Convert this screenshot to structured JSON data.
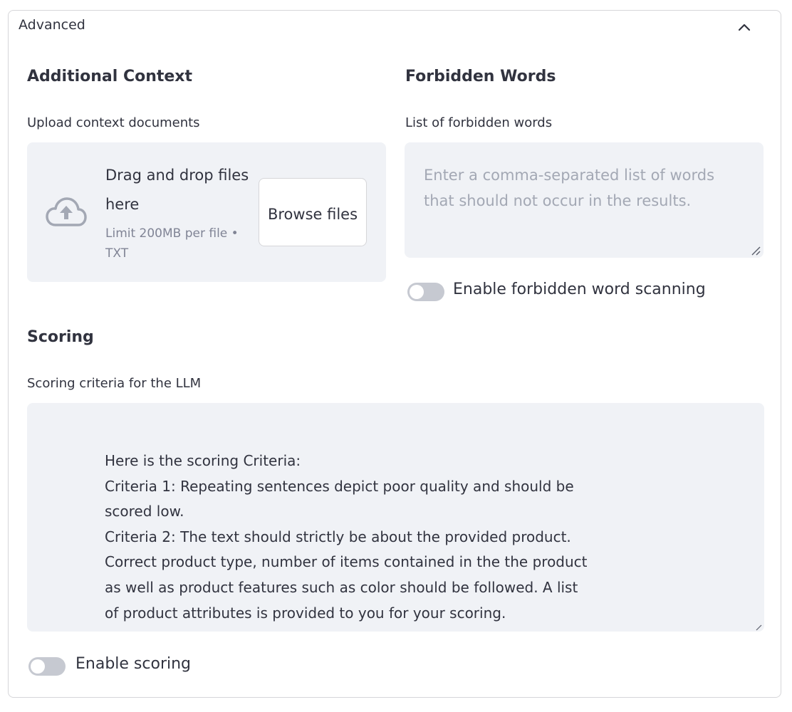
{
  "expander": {
    "title": "Advanced"
  },
  "additional_context": {
    "heading": "Additional Context",
    "upload_label": "Upload context documents",
    "dropzone_text": "Drag and drop files here",
    "limit_text": "Limit 200MB per file • TXT",
    "browse_label": "Browse files"
  },
  "forbidden_words": {
    "heading": "Forbidden Words",
    "list_label": "List of forbidden words",
    "placeholder": "Enter a comma-separated list of words that should not occur in the results.",
    "toggle_label": "Enable forbidden word scanning",
    "toggle_on": false
  },
  "scoring": {
    "heading": "Scoring",
    "criteria_label": "Scoring criteria for the LLM",
    "criteria_text": "Here is the scoring Criteria:\nCriteria 1: Repeating sentences depict poor quality and should be\nscored low.\nCriteria 2: The text should strictly be about the provided product.\nCorrect product type, number of items contained in the the product\nas well as product features such as color should be followed. A list\nof product attributes is provided to you for your scoring.",
    "toggle_label": "Enable scoring",
    "toggle_on": false
  },
  "colors": {
    "text": "#31333f",
    "muted": "#808495",
    "placeholder": "#a3a8b4",
    "surface": "#f0f2f6",
    "border": "#d6d6d9",
    "toggle_off": "#c6c9d1"
  },
  "icons": {
    "expander": "chevron-up-icon",
    "uploader": "cloud-upload-icon",
    "resize": "resize-handle-icon"
  }
}
